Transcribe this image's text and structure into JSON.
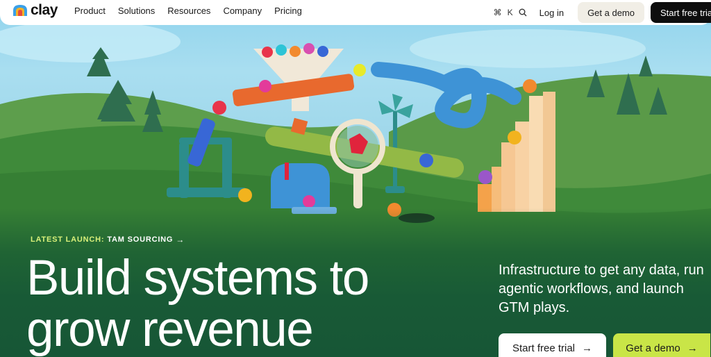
{
  "brand": {
    "name": "clay"
  },
  "nav": {
    "links": [
      "Product",
      "Solutions",
      "Resources",
      "Company",
      "Pricing"
    ],
    "shortcut_keys": [
      "⌘",
      "K"
    ],
    "login": "Log in",
    "demo_button": "Get a demo",
    "trial_button": "Start free trial"
  },
  "hero": {
    "launch_label": "LATEST LAUNCH:",
    "launch_title": "TAM SOURCING",
    "launch_arrow": "→",
    "headline": "Build systems to grow revenue",
    "subtext": "Infrastructure to get any data, run agentic workflows, and launch GTM plays.",
    "cta_primary": "Start free trial",
    "cta_secondary": "Get a demo",
    "cta_arrow": "→"
  },
  "icons": {
    "logo": "clay-logo-icon",
    "search": "search-icon",
    "arrow": "arrow-right-icon"
  },
  "colors": {
    "accent_lime": "#c9e547",
    "launch_label": "#d9f07a",
    "hero_green": "#185a36",
    "nav_dark": "#0e0e0e"
  }
}
